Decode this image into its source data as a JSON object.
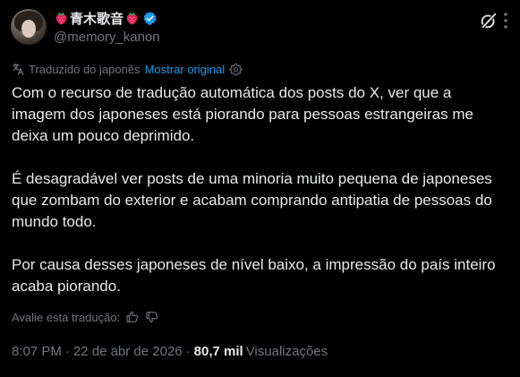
{
  "author": {
    "display_name": "青木歌音",
    "handle": "@memory_kanon",
    "verified": true
  },
  "icons": {
    "avatar": "avatar-photo",
    "name_emoji": "strawberry-icon",
    "verified": "verified-badge-icon",
    "grok": "grok-icon",
    "more": "more-options-icon",
    "translate": "translate-icon",
    "settings": "settings-gear-icon",
    "thumbs_up": "thumbs-up-icon",
    "thumbs_down": "thumbs-down-icon"
  },
  "translation": {
    "translated_from": "Traduzido do japonês",
    "show_original": "Mostrar original"
  },
  "post": {
    "paragraphs": [
      "Com o recurso de tradução automática dos posts do X, ver que a imagem dos japoneses está piorando para pessoas estrangeiras me deixa um pouco deprimido.",
      "É desagradável ver posts de uma minoria muito pequena de japoneses que zombam do exterior e acabam comprando antipatia de pessoas do mundo todo.",
      "Por causa desses japoneses de nível baixo, a impressão do país inteiro acaba piorando."
    ]
  },
  "rating": {
    "label": "Avalie esta tradução:"
  },
  "meta": {
    "time": "8:07 PM",
    "separator": "·",
    "date": "22 de abr de 2026",
    "views_count": "80,7 mil",
    "views_label": "Visualizações"
  },
  "colors": {
    "background": "#000000",
    "text_primary": "#e7e9ea",
    "text_secondary": "#71767b",
    "link": "#1d9bf0",
    "verified": "#1d9bf0",
    "strawberry": "#e0245e"
  }
}
